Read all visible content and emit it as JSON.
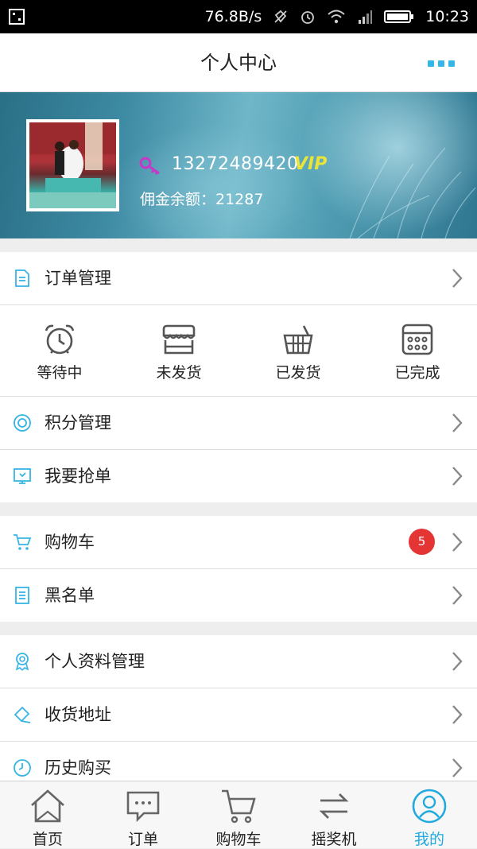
{
  "status_bar": {
    "speed": "76.8B/s",
    "time": "10:23",
    "icons": [
      "screenshot-icon",
      "mute-icon",
      "alarm-icon",
      "wifi-icon",
      "signal-icon",
      "battery-icon"
    ]
  },
  "nav": {
    "title": "个人中心",
    "more_icon": "more-dots-icon"
  },
  "profile": {
    "phone": "13272489420",
    "vip": "VIP",
    "balance": "佣金余额：21287",
    "key_icon_color": "#c838c8"
  },
  "order_management": {
    "label": "订单管理",
    "statuses": [
      {
        "label": "等待中",
        "icon": "alarm-clock-icon"
      },
      {
        "label": "未发货",
        "icon": "store-icon"
      },
      {
        "label": "已发货",
        "icon": "basket-icon"
      },
      {
        "label": "已完成",
        "icon": "calendar-icon"
      }
    ]
  },
  "menu": {
    "points": "积分管理",
    "grab_orders": "我要抢单",
    "cart": "购物车",
    "cart_badge": "5",
    "blacklist": "黑名单",
    "profile_management": "个人资料管理",
    "address": "收货地址",
    "history": "历史购买"
  },
  "tabbar": {
    "items": [
      {
        "label": "首页",
        "icon": "home-icon"
      },
      {
        "label": "订单",
        "icon": "chat-order-icon"
      },
      {
        "label": "购物车",
        "icon": "cart-icon"
      },
      {
        "label": "摇奖机",
        "icon": "swap-icon"
      },
      {
        "label": "我的",
        "icon": "user-icon"
      }
    ],
    "active_index": 4
  },
  "colors": {
    "accent": "#22aadf",
    "badge": "#e43434",
    "vip": "#e8e43a"
  }
}
